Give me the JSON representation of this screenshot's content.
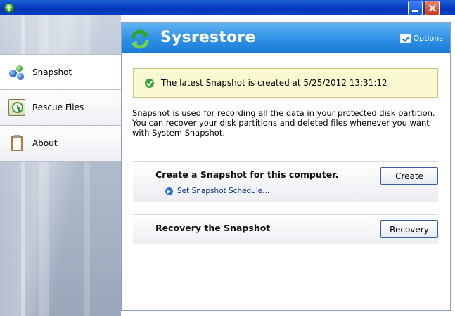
{
  "window": {
    "icon": "plus-icon",
    "icon_glyph": "+",
    "title": ""
  },
  "header": {
    "brand": "Sysrestore",
    "options_label": "Options",
    "logo_icon": "refresh-arrows-icon",
    "banner_color": "#2c8fe4"
  },
  "sidebar": {
    "items": [
      {
        "label": "Snapshot",
        "icon": "snapshot-icon",
        "active": true
      },
      {
        "label": "Rescue Files",
        "icon": "rescue-clock-icon",
        "active": false
      },
      {
        "label": "About",
        "icon": "clipboard-icon",
        "active": false
      }
    ]
  },
  "main": {
    "status": {
      "text": "The latest Snapshot is created at 5/25/2012 13:31:12",
      "icon": "check-circle-icon",
      "color": "#3aa23a"
    },
    "description": "Snapshot is used for recording all the data in your protected disk partition. You can recover your disk partitions and deleted files whenever you want with System Snapshot.",
    "create_section": {
      "title": "Create a Snapshot for this computer.",
      "button": "Create",
      "link": "Set Snapshot Schedule..."
    },
    "recovery_section": {
      "title": "Recovery the Snapshot",
      "button": "Recovery"
    }
  }
}
